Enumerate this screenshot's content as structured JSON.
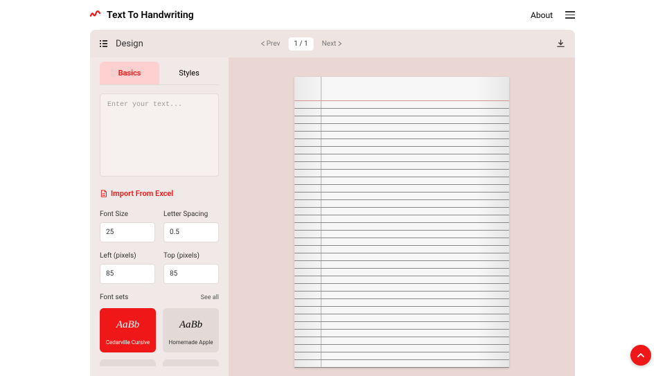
{
  "header": {
    "title": "Text To Handwriting",
    "about": "About"
  },
  "toolbar": {
    "design_label": "Design",
    "prev_label": "Prev",
    "page_indicator": "1 / 1",
    "next_label": "Next"
  },
  "tabs": {
    "basics": "Basics",
    "styles": "Styles"
  },
  "input": {
    "placeholder": "Enter your text..."
  },
  "import": {
    "label": "Import From Excel"
  },
  "fields": {
    "font_size": {
      "label": "Font Size",
      "value": "25"
    },
    "letter_spacing": {
      "label": "Letter Spacing",
      "value": "0.5"
    },
    "left": {
      "label": "Left (pixels)",
      "value": "85"
    },
    "top": {
      "label": "Top (pixels)",
      "value": "85"
    }
  },
  "font_sets": {
    "title": "Font sets",
    "see_all": "See all",
    "cards": [
      {
        "preview": "AaBb",
        "name": "Cedarville Cursive",
        "selected": true
      },
      {
        "preview": "AaBb",
        "name": "Homemade Apple",
        "selected": false
      }
    ]
  }
}
